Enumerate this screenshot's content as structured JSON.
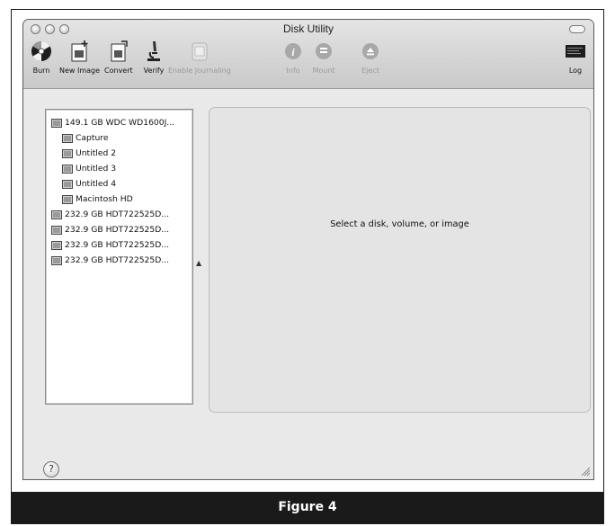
{
  "window": {
    "title": "Disk Utility"
  },
  "toolbar": {
    "items": [
      {
        "label": "Burn",
        "icon": "burn-icon",
        "enabled": true
      },
      {
        "label": "New Image",
        "icon": "new-image-icon",
        "enabled": true
      },
      {
        "label": "Convert",
        "icon": "convert-icon",
        "enabled": true
      },
      {
        "label": "Verify",
        "icon": "microscope-icon",
        "enabled": true
      },
      {
        "label": "Enable Journaling",
        "icon": "journaling-icon",
        "enabled": false
      },
      {
        "label": "Info",
        "icon": "info-icon",
        "enabled": false
      },
      {
        "label": "Mount",
        "icon": "mount-icon",
        "enabled": false
      },
      {
        "label": "Eject",
        "icon": "eject-icon",
        "enabled": false
      },
      {
        "label": "Log",
        "icon": "log-icon",
        "enabled": true
      }
    ]
  },
  "disks": [
    {
      "label": "149.1 GB WDC WD1600J...",
      "level": 0
    },
    {
      "label": "Capture",
      "level": 1
    },
    {
      "label": "Untitled 2",
      "level": 1
    },
    {
      "label": "Untitled 3",
      "level": 1
    },
    {
      "label": "Untitled 4",
      "level": 1
    },
    {
      "label": "Macintosh HD",
      "level": 1
    },
    {
      "label": "232.9 GB HDT722525D...",
      "level": 0
    },
    {
      "label": "232.9 GB HDT722525D...",
      "level": 0
    },
    {
      "label": "232.9 GB HDT722525D...",
      "level": 0
    },
    {
      "label": "232.9 GB HDT722525D...",
      "level": 0
    }
  ],
  "detail": {
    "prompt": "Select a disk, volume, or image"
  },
  "help_label": "?",
  "caption": "Figure 4"
}
